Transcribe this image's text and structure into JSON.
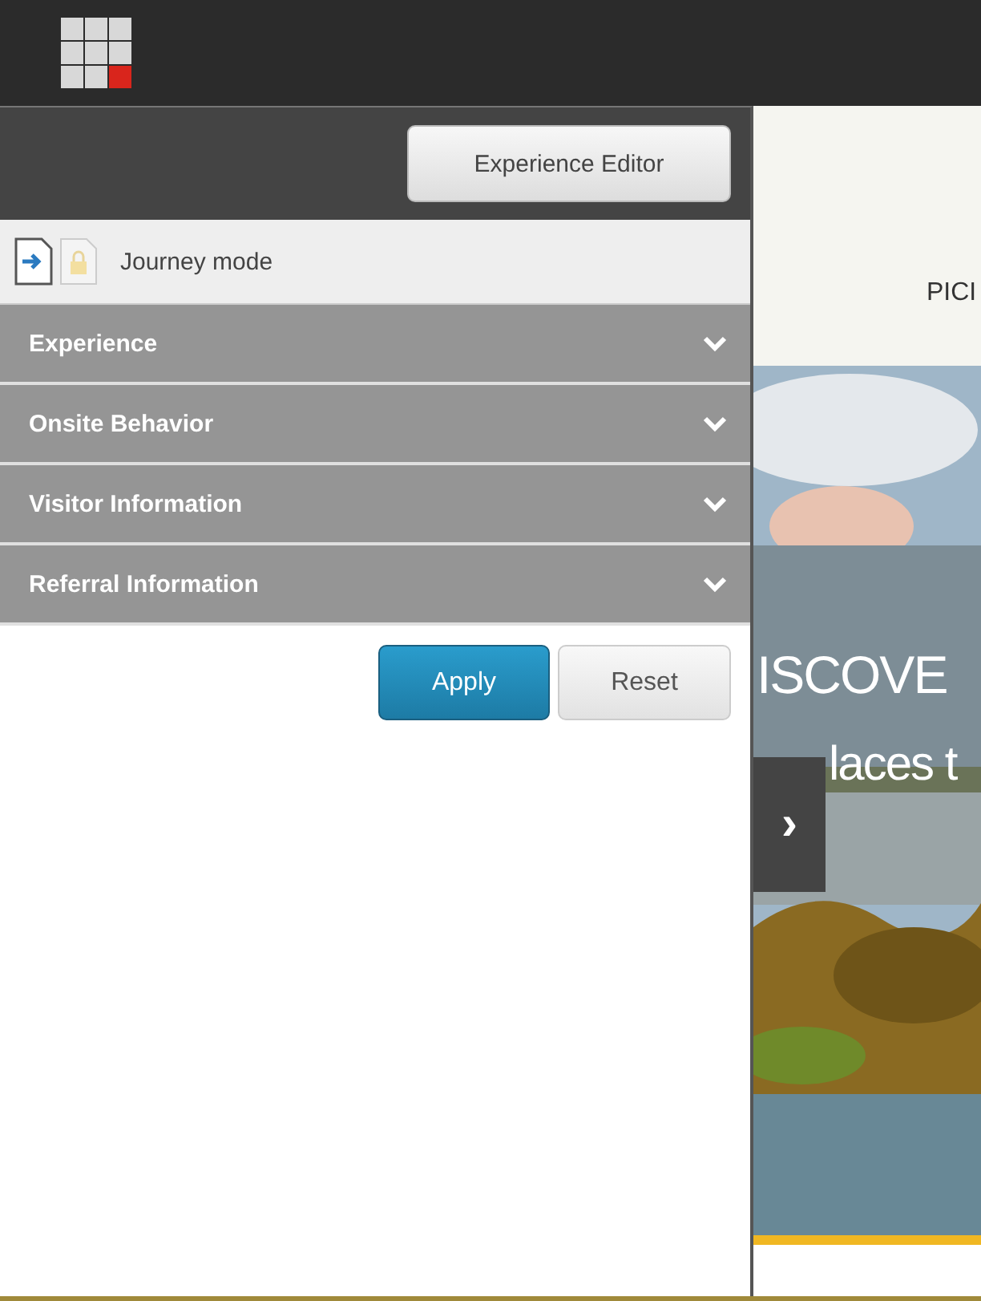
{
  "panel": {
    "editor_button": "Experience Editor",
    "journey_mode": {
      "label": "Journey mode"
    },
    "sections": [
      {
        "label": "Experience",
        "expanded": false
      },
      {
        "label": "Onsite Behavior",
        "expanded": false
      },
      {
        "label": "Visitor Information",
        "expanded": false
      },
      {
        "label": "Referral Information",
        "expanded": false
      }
    ],
    "buttons": [
      {
        "label": "Apply",
        "kind": "primary"
      },
      {
        "label": "Reset",
        "kind": "secondary"
      }
    ]
  },
  "site": {
    "header_text": "PICI",
    "hero": {
      "kind": "picture",
      "headline": "ISCOVE",
      "subline": "laces t"
    },
    "next_button": "›"
  }
}
